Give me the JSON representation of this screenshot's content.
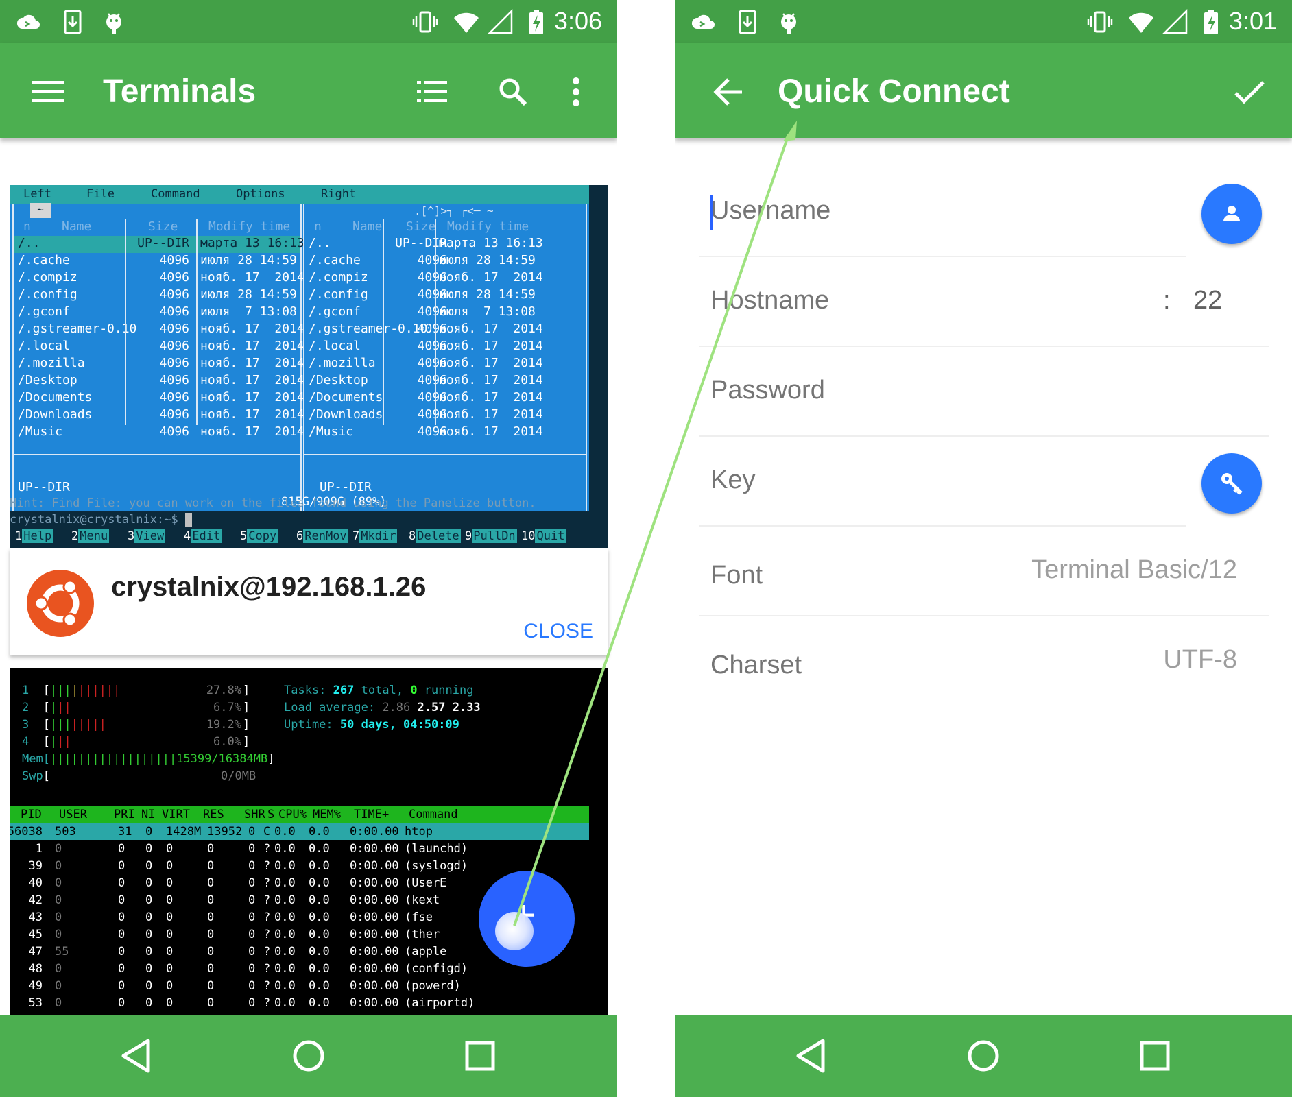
{
  "left": {
    "status_time": "3:06",
    "title": "Terminals",
    "mc": {
      "menu": [
        "Left",
        "File",
        "Command",
        "Options",
        "Right"
      ],
      "tilde": "~",
      "top_right_marker": ".[^]>┐ ┌<─ ~",
      "col_headers": {
        "n": "n",
        "name": "Name",
        "size": "Size",
        "mtime": "Modify time"
      },
      "rows": [
        {
          "name": "/..",
          "size": "UP--DIR",
          "time": "марта 13 16:13"
        },
        {
          "name": "/.cache",
          "size": "4096",
          "time": "июля 28 14:59"
        },
        {
          "name": "/.compiz",
          "size": "4096",
          "time": "нояб. 17  2014"
        },
        {
          "name": "/.config",
          "size": "4096",
          "time": "июля 28 14:59"
        },
        {
          "name": "/.gconf",
          "size": "4096",
          "time": "июля  7 13:08"
        },
        {
          "name": "/.gstreamer-0.10",
          "size": "4096",
          "time": "нояб. 17  2014"
        },
        {
          "name": "/.local",
          "size": "4096",
          "time": "нояб. 17  2014"
        },
        {
          "name": "/.mozilla",
          "size": "4096",
          "time": "нояб. 17  2014"
        },
        {
          "name": "/Desktop",
          "size": "4096",
          "time": "нояб. 17  2014"
        },
        {
          "name": "/Documents",
          "size": "4096",
          "time": "нояб. 17  2014"
        },
        {
          "name": "/Downloads",
          "size": "4096",
          "time": "нояб. 17  2014"
        },
        {
          "name": "/Music",
          "size": "4096",
          "time": "нояб. 17  2014"
        }
      ],
      "status_left": "UP--DIR",
      "status_right": "UP--DIR",
      "disk": "815G/909G (89%)",
      "hint": "Hint: Find File: you can work on the files found using the Panelize button.",
      "prompt": "crystalnix@crystalnix:~$",
      "fkeys": [
        {
          "n": "1",
          "l": "Help"
        },
        {
          "n": "2",
          "l": "Menu"
        },
        {
          "n": "3",
          "l": "View"
        },
        {
          "n": "4",
          "l": "Edit"
        },
        {
          "n": "5",
          "l": "Copy"
        },
        {
          "n": "6",
          "l": "RenMov"
        },
        {
          "n": "7",
          "l": "Mkdir"
        },
        {
          "n": "8",
          "l": "Delete"
        },
        {
          "n": "9",
          "l": "PullDn"
        },
        {
          "n": "10",
          "l": "Quit"
        }
      ]
    },
    "host": "crystalnix@192.168.1.26",
    "close_label": "CLOSE",
    "htop": {
      "cpus": [
        {
          "n": "1",
          "bar": "||||||||||",
          "pct": "27.8%"
        },
        {
          "n": "2",
          "bar": "|||",
          "pct": "6.7%"
        },
        {
          "n": "3",
          "bar": "||||||||",
          "pct": "19.2%"
        },
        {
          "n": "4",
          "bar": "|||",
          "pct": "6.0%"
        }
      ],
      "mem": "||||||||||||||||||15399/16384MB",
      "swp": "0/0MB",
      "tasks_label": "Tasks:",
      "tasks": "267",
      "tasks_total": "total,",
      "running": "0",
      "running_label": "running",
      "load_label": "Load average:",
      "load1": "2.86",
      "load2": "2.57",
      "load3": "2.33",
      "uptime_label": "Uptime:",
      "uptime": "50 days, 04:50:09",
      "headers": [
        "PID",
        "USER",
        "PRI",
        "NI",
        "VIRT",
        "RES",
        "SHR",
        "S",
        "CPU%",
        "MEM%",
        "TIME+",
        "Command"
      ],
      "rows": [
        [
          "56038",
          "503",
          "31",
          "0",
          "1428M",
          "13952",
          "0",
          "C",
          "0.0",
          "0.0",
          "0:00.00",
          "htop"
        ],
        [
          "1",
          "0",
          "0",
          "0",
          "0",
          "0",
          "0",
          "?",
          "0.0",
          "0.0",
          "0:00.00",
          "(launchd)"
        ],
        [
          "39",
          "0",
          "0",
          "0",
          "0",
          "0",
          "0",
          "?",
          "0.0",
          "0.0",
          "0:00.00",
          "(syslogd)"
        ],
        [
          "40",
          "0",
          "0",
          "0",
          "0",
          "0",
          "0",
          "?",
          "0.0",
          "0.0",
          "0:00.00",
          "(UserE"
        ],
        [
          "42",
          "0",
          "0",
          "0",
          "0",
          "0",
          "0",
          "?",
          "0.0",
          "0.0",
          "0:00.00",
          "(kext"
        ],
        [
          "43",
          "0",
          "0",
          "0",
          "0",
          "0",
          "0",
          "?",
          "0.0",
          "0.0",
          "0:00.00",
          "(fse"
        ],
        [
          "45",
          "0",
          "0",
          "0",
          "0",
          "0",
          "0",
          "?",
          "0.0",
          "0.0",
          "0:00.00",
          "(ther"
        ],
        [
          "47",
          "55",
          "0",
          "0",
          "0",
          "0",
          "0",
          "?",
          "0.0",
          "0.0",
          "0:00.00",
          "(apple"
        ],
        [
          "48",
          "0",
          "0",
          "0",
          "0",
          "0",
          "0",
          "?",
          "0.0",
          "0.0",
          "0:00.00",
          "(configd)"
        ],
        [
          "49",
          "0",
          "0",
          "0",
          "0",
          "0",
          "0",
          "?",
          "0.0",
          "0.0",
          "0:00.00",
          "(powerd)"
        ],
        [
          "53",
          "0",
          "0",
          "0",
          "0",
          "0",
          "0",
          "?",
          "0.0",
          "0.0",
          "0:00.00",
          "(airportd)"
        ]
      ]
    },
    "fab_icon": "plus-icon"
  },
  "right": {
    "status_time": "3:01",
    "title": "Quick Connect",
    "fields": {
      "username": {
        "label": "Username"
      },
      "hostname": {
        "label": "Hostname",
        "sep": ":",
        "port": "22"
      },
      "password": {
        "label": "Password"
      },
      "key": {
        "label": "Key"
      },
      "font": {
        "label": "Font",
        "value": "Terminal Basic/12"
      },
      "charset": {
        "label": "Charset",
        "value": "UTF-8"
      }
    }
  },
  "colors": {
    "appbar": "#4caf50",
    "statusbar": "#43a047",
    "accent": "#2979ff",
    "fab": "#2962ff",
    "arrow": "#9ee27f"
  }
}
